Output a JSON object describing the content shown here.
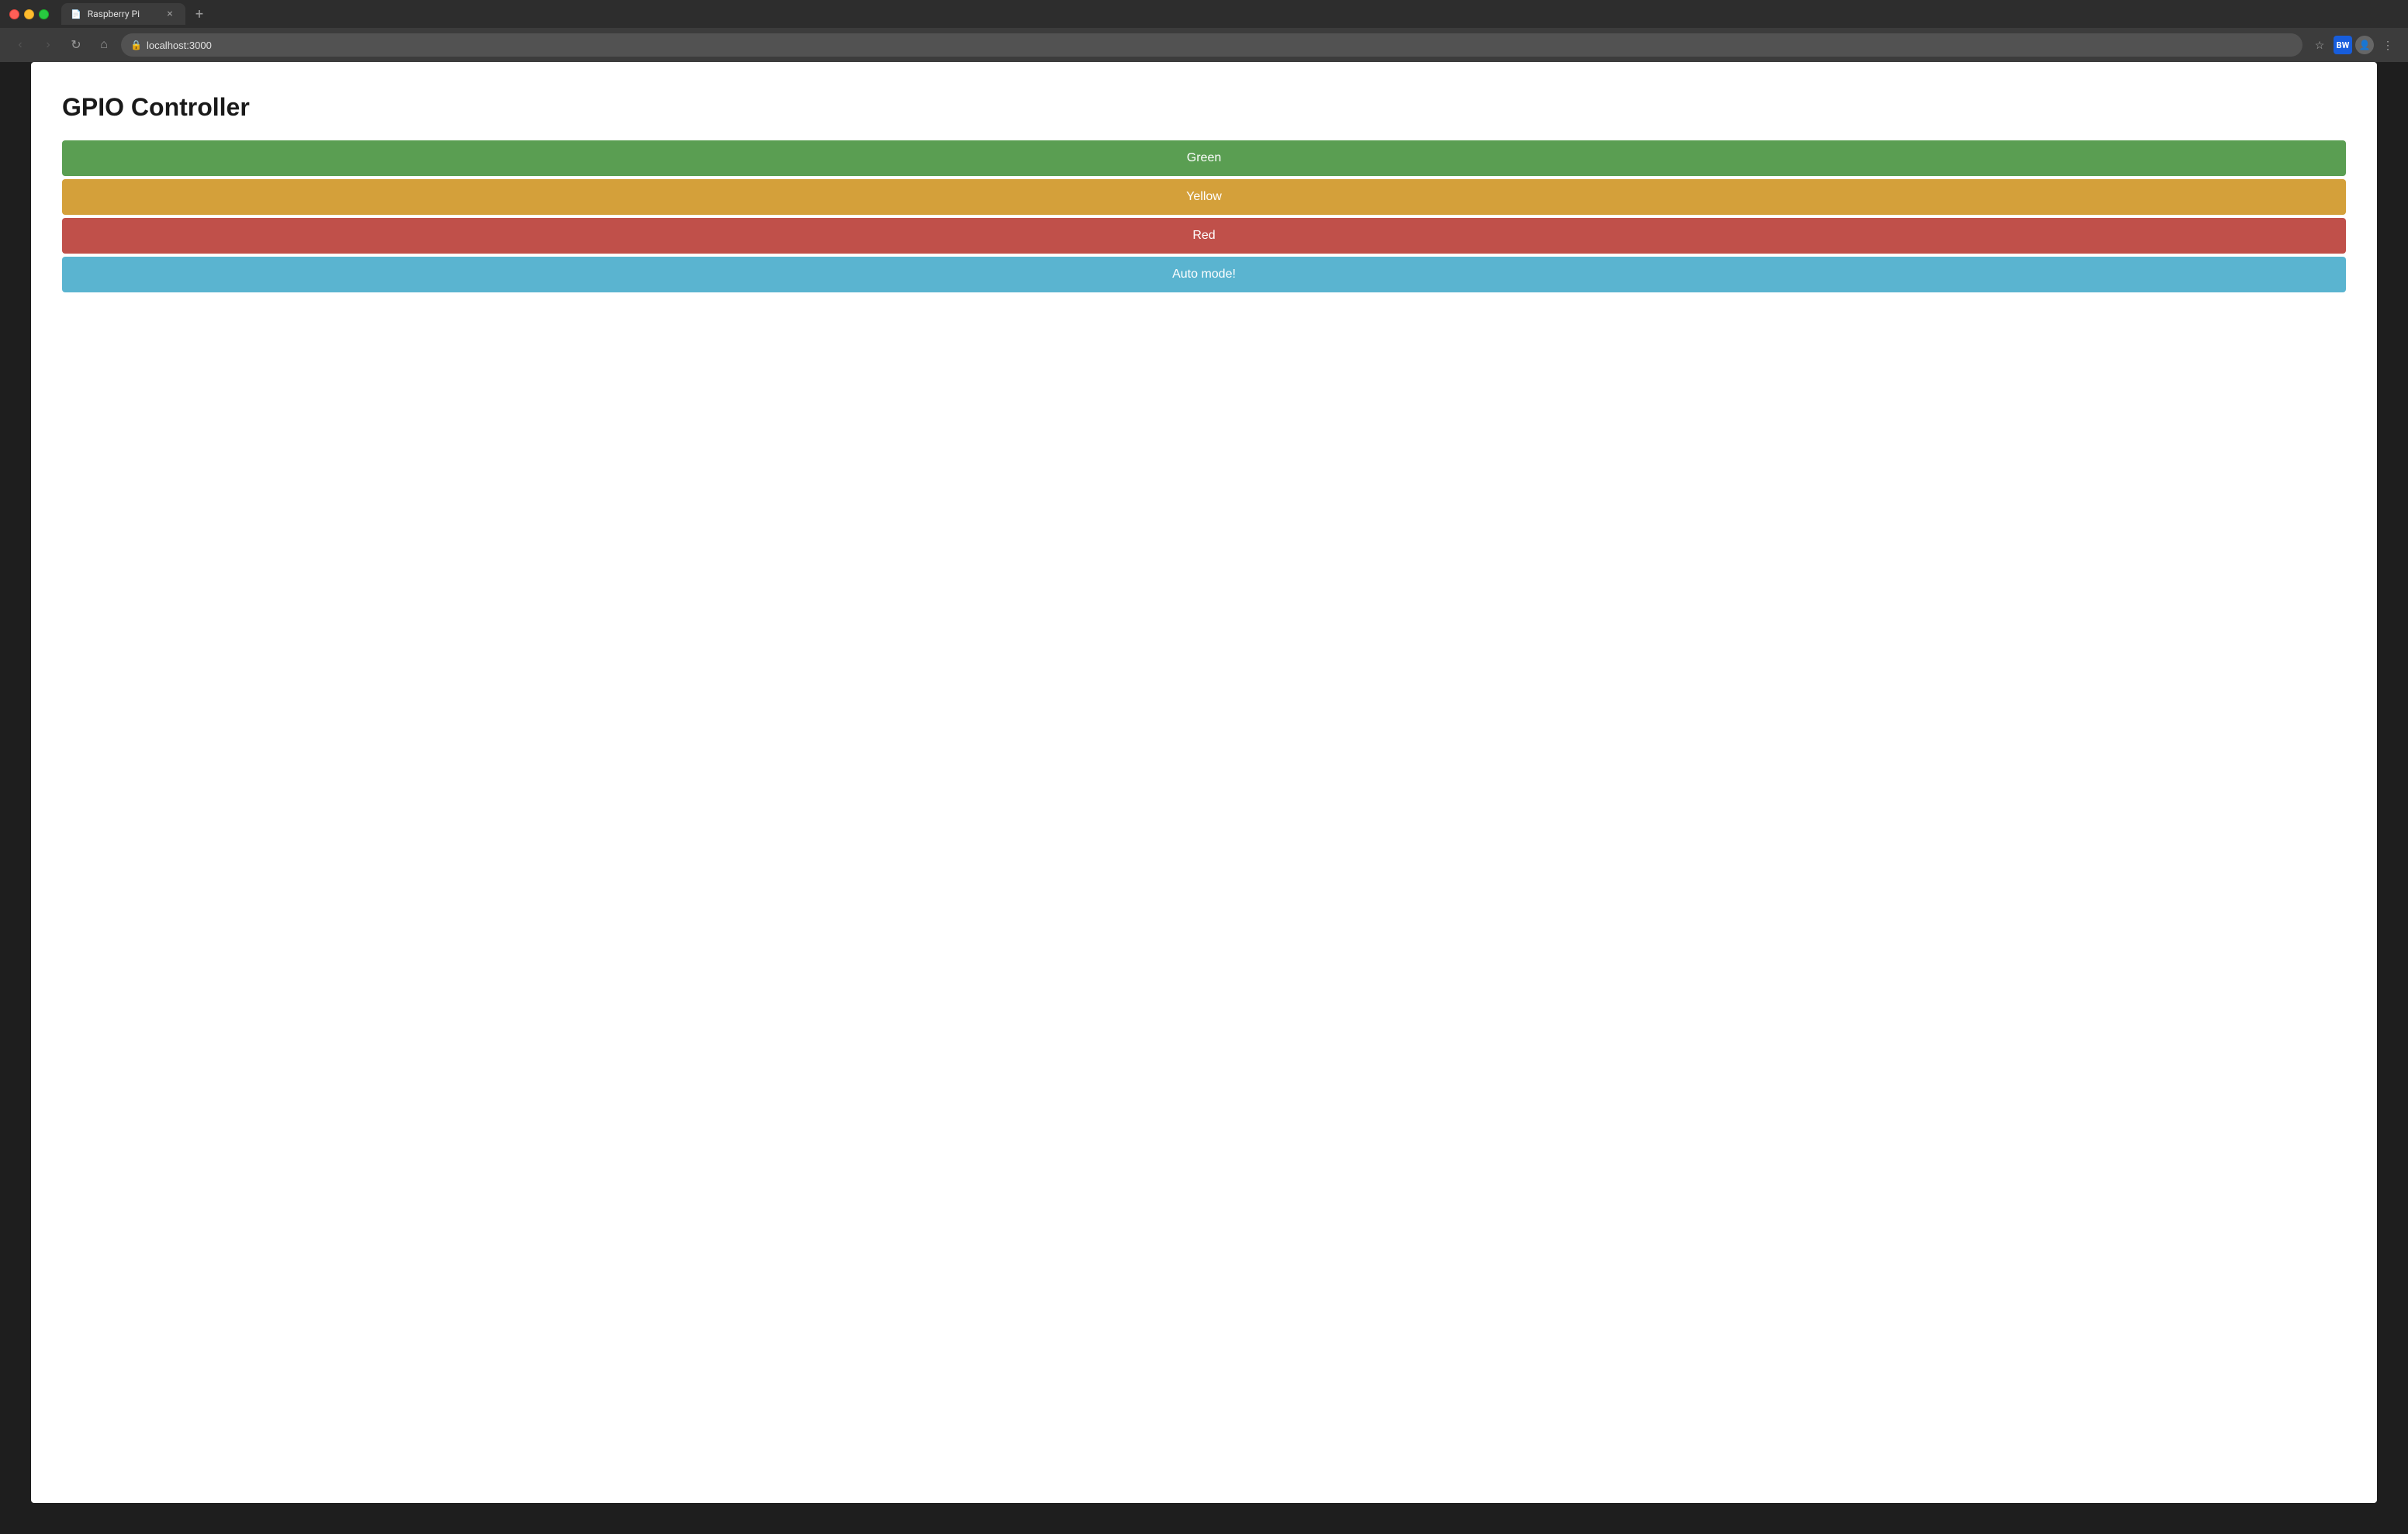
{
  "titleBar": {
    "trafficLights": {
      "close": "close",
      "minimize": "minimize",
      "maximize": "maximize"
    },
    "tab": {
      "title": "Raspberry Pi",
      "closeLabel": "×"
    },
    "newTabLabel": "+"
  },
  "navBar": {
    "backButton": "‹",
    "forwardButton": "›",
    "reloadButton": "↻",
    "homeButton": "⌂",
    "addressBar": {
      "url": "localhost:3000",
      "lockIcon": "🔒"
    },
    "starIcon": "☆",
    "bitwardenLabel": "BW",
    "avatarIcon": "👤",
    "menuIcon": "⋮"
  },
  "page": {
    "title": "GPIO Controller",
    "buttons": [
      {
        "label": "Green",
        "colorClass": "green",
        "color": "#5a9e52"
      },
      {
        "label": "Yellow",
        "colorClass": "yellow",
        "color": "#d4a03a"
      },
      {
        "label": "Red",
        "colorClass": "red",
        "color": "#c0504a"
      },
      {
        "label": "Auto mode!",
        "colorClass": "blue",
        "color": "#5ab4d0"
      }
    ]
  }
}
